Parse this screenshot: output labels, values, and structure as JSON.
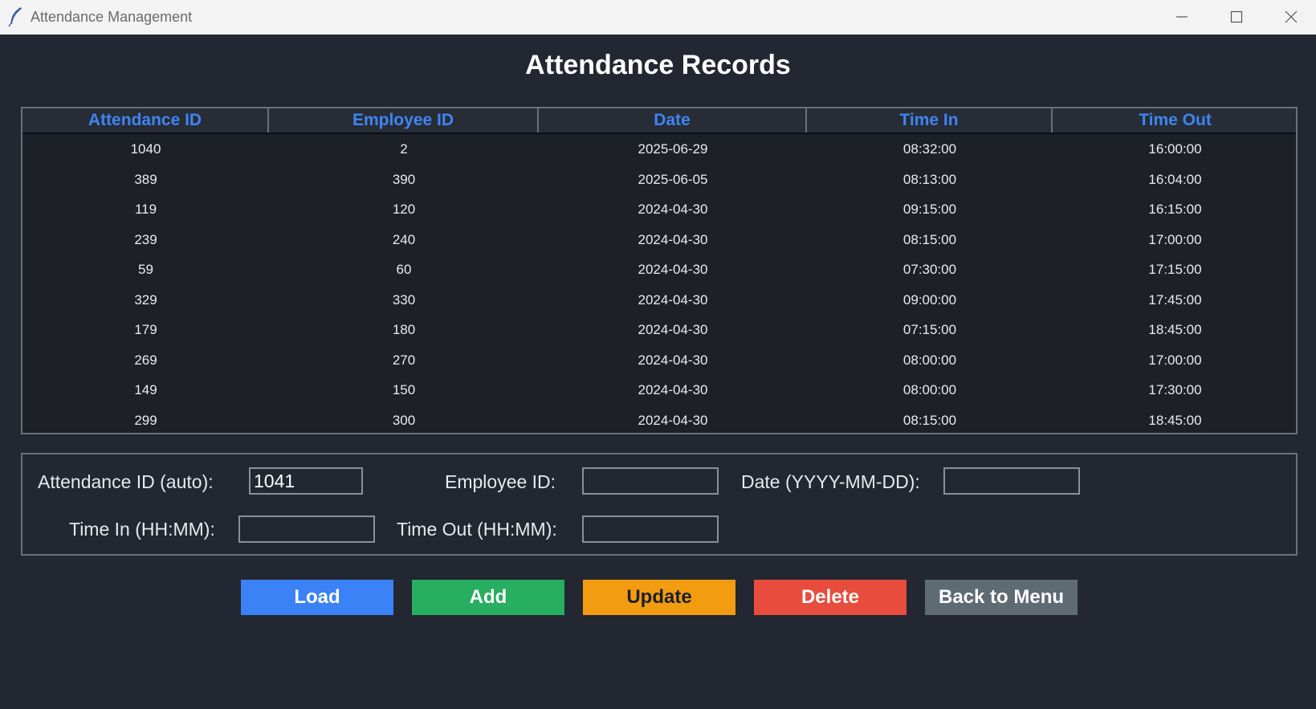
{
  "window": {
    "title": "Attendance Management",
    "icon": "feather-icon"
  },
  "heading": "Attendance Records",
  "table": {
    "columns": [
      "Attendance ID",
      "Employee ID",
      "Date",
      "Time In",
      "Time Out"
    ],
    "rows": [
      [
        "1040",
        "2",
        "2025-06-29",
        "08:32:00",
        "16:00:00"
      ],
      [
        "389",
        "390",
        "2025-06-05",
        "08:13:00",
        "16:04:00"
      ],
      [
        "119",
        "120",
        "2024-04-30",
        "09:15:00",
        "16:15:00"
      ],
      [
        "239",
        "240",
        "2024-04-30",
        "08:15:00",
        "17:00:00"
      ],
      [
        "59",
        "60",
        "2024-04-30",
        "07:30:00",
        "17:15:00"
      ],
      [
        "329",
        "330",
        "2024-04-30",
        "09:00:00",
        "17:45:00"
      ],
      [
        "179",
        "180",
        "2024-04-30",
        "07:15:00",
        "18:45:00"
      ],
      [
        "269",
        "270",
        "2024-04-30",
        "08:00:00",
        "17:00:00"
      ],
      [
        "149",
        "150",
        "2024-04-30",
        "08:00:00",
        "17:30:00"
      ],
      [
        "299",
        "300",
        "2024-04-30",
        "08:15:00",
        "18:45:00"
      ]
    ]
  },
  "form": {
    "attendance_id_label": "Attendance ID (auto):",
    "attendance_id_value": "1041",
    "employee_id_label": "Employee ID:",
    "employee_id_value": "",
    "date_label": "Date (YYYY-MM-DD):",
    "date_value": "",
    "time_in_label": "Time In (HH:MM):",
    "time_in_value": "",
    "time_out_label": "Time Out (HH:MM):",
    "time_out_value": ""
  },
  "buttons": {
    "load": "Load",
    "add": "Add",
    "update": "Update",
    "delete": "Delete",
    "back": "Back to Menu"
  },
  "colors": {
    "background": "#222731",
    "header_text": "#3e86f2",
    "load": "#3b82f6",
    "add": "#27ae60",
    "update": "#f39c12",
    "delete": "#e74c3c",
    "back": "#5f6b73"
  }
}
